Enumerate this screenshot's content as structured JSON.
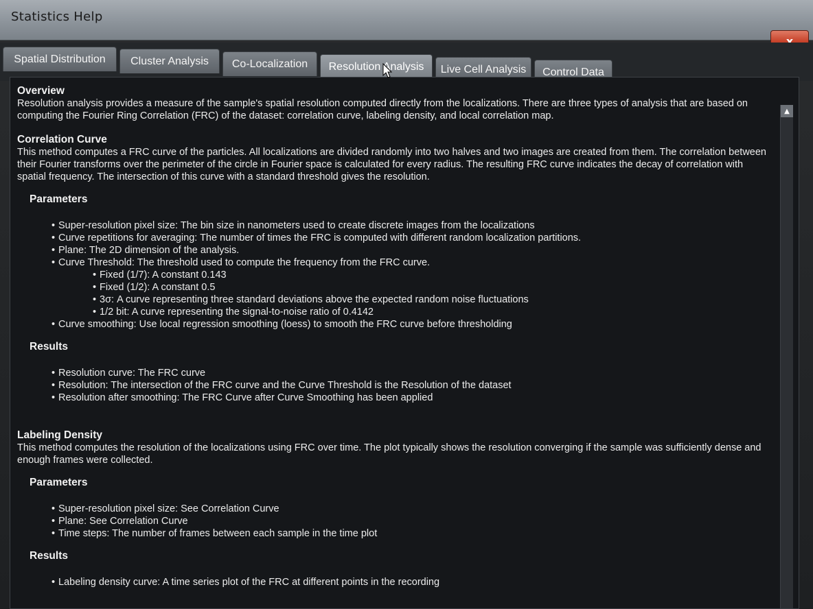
{
  "window": {
    "title": "Statistics Help",
    "close_glyph": "x"
  },
  "tabs": [
    {
      "label": "Spatial Distribution"
    },
    {
      "label": "Cluster Analysis"
    },
    {
      "label": "Co-Localization"
    },
    {
      "label": "Resolution Analysis"
    },
    {
      "label": "Live Cell Analysis"
    },
    {
      "label": "Control Data"
    }
  ],
  "active_tab": "Resolution Analysis",
  "help": {
    "overview": {
      "heading": "Overview",
      "text": "Resolution analysis provides a measure of the sample's spatial resolution computed directly from the localizations.  There are three types of analysis that are based on computing the Fourier Ring Correlation (FRC) of the dataset: correlation curve, labeling density, and local correlation map."
    },
    "correlation_curve": {
      "heading": "Correlation Curve",
      "text": "This method computes a FRC curve of the particles.  All localizations are divided randomly into two halves and two images are created from them.  The correlation between their Fourier transforms over the perimeter of the circle in Fourier space is calculated for every radius.  The resulting FRC curve indicates the decay of correlation with spatial frequency.  The intersection of this curve with a standard threshold gives the resolution.",
      "parameters_heading": "Parameters",
      "parameters": [
        "Super-resolution pixel size:  The bin size in nanometers used to create discrete images from the localizations",
        "Curve repetitions for averaging: The number of times the FRC is computed with different random localization partitions.",
        "Plane: The 2D dimension of the analysis.",
        "Curve Threshold: The threshold used to compute the frequency from the FRC curve."
      ],
      "threshold_options": [
        "Fixed (1/7): A constant 0.143",
        "Fixed (1/2): A constant 0.5",
        "3σ: A curve representing three standard deviations above the expected random noise fluctuations",
        "1/2 bit: A curve representing the signal-to-noise ratio of 0.4142"
      ],
      "parameters_last": "Curve smoothing: Use local regression smoothing (loess) to smooth the FRC curve before thresholding",
      "results_heading": "Results",
      "results": [
        "Resolution curve:  The FRC curve",
        "Resolution: The intersection of the FRC curve and the Curve Threshold is the Resolution of the dataset",
        "Resolution after smoothing:  The FRC Curve after Curve Smoothing has been applied"
      ]
    },
    "labeling_density": {
      "heading": "Labeling Density",
      "text": "This method computes the resolution of the localizations using FRC over time.  The plot typically shows the resolution converging if the sample was sufficiently dense and enough frames were collected.",
      "parameters_heading": "Parameters",
      "parameters": [
        "Super-resolution pixel size: See Correlation Curve",
        "Plane: See Correlation Curve",
        "Time steps: The number of frames between each sample in the time plot"
      ],
      "results_heading": "Results",
      "results": [
        "Labeling density curve: A time series plot of the FRC at different points in the recording"
      ]
    }
  }
}
